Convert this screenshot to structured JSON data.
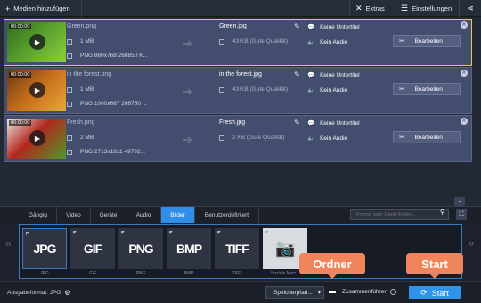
{
  "toolbar": {
    "add_media_label": "Medien hinzufügen",
    "extras_label": "Extras",
    "settings_label": "Einstellungen"
  },
  "files": [
    {
      "thumb_timecode": "00:00:00",
      "source_name": "Green.png",
      "source_size": "1 MB",
      "source_info": "PNG 860x768 268850 K...",
      "output_name": "Green.jpg",
      "output_size": "43 KB (Gute Qualität)",
      "subtitle": "Keine Untertitel",
      "audio": "Kein Audio",
      "edit_label": "Bearbeiten",
      "thumb_colors": [
        "#2f6b1e",
        "#5aa12f",
        "#8fcf3e"
      ]
    },
    {
      "thumb_timecode": "00:00:00",
      "source_name": "in the forest.png",
      "source_size": "1 MB",
      "source_info": "PNG 1000x667 266750 ...",
      "output_name": "in the forest.jpg",
      "output_size": "43 KB (Gute Qualität)",
      "subtitle": "Keine Untertitel",
      "audio": "Kein Audio",
      "edit_label": "Bearbeiten",
      "thumb_colors": [
        "#6b3a12",
        "#c86f1c",
        "#e6a83a"
      ]
    },
    {
      "thumb_timecode": "00:00:00",
      "source_name": "Fresh.png",
      "source_size": "2 MB",
      "source_info": "PNG 2713x1811 49792...",
      "output_name": "Fresh.jpg",
      "output_size": "2 KB (Gute Qualität)",
      "subtitle": "Keine Untertitel",
      "audio": "Kein Audio",
      "edit_label": "Bearbeiten",
      "thumb_colors": [
        "#b3261e",
        "#e8e8e2",
        "#4d9a2a"
      ]
    }
  ],
  "tabs": [
    "Gängig",
    "Video",
    "Geräte",
    "Audio",
    "Bilder",
    "Benutzerdefiniert"
  ],
  "active_tab": "Bilder",
  "search_placeholder": "Format oder Gerät finden...",
  "formats": [
    {
      "title": "JPG",
      "label": "JPG"
    },
    {
      "title": "GIF",
      "label": "GIF"
    },
    {
      "title": "PNG",
      "label": "PNG"
    },
    {
      "title": "BMP",
      "label": "BMP"
    },
    {
      "title": "TIFF",
      "label": "TIFF"
    },
    {
      "title": "",
      "label": "Soziale Netz..."
    }
  ],
  "bottom": {
    "output_format": "Ausgabeformat: JPG",
    "save_path": "Speicherpfad...",
    "merge_label": "Zusammenführen",
    "start_label": "Start"
  },
  "callouts": {
    "folder": "Ordner",
    "start": "Start"
  },
  "colors": {
    "accent": "#2f8ee8",
    "callout": "#f0845b",
    "selected_border": "#e7c95c",
    "row_bg": "#434d6e"
  }
}
